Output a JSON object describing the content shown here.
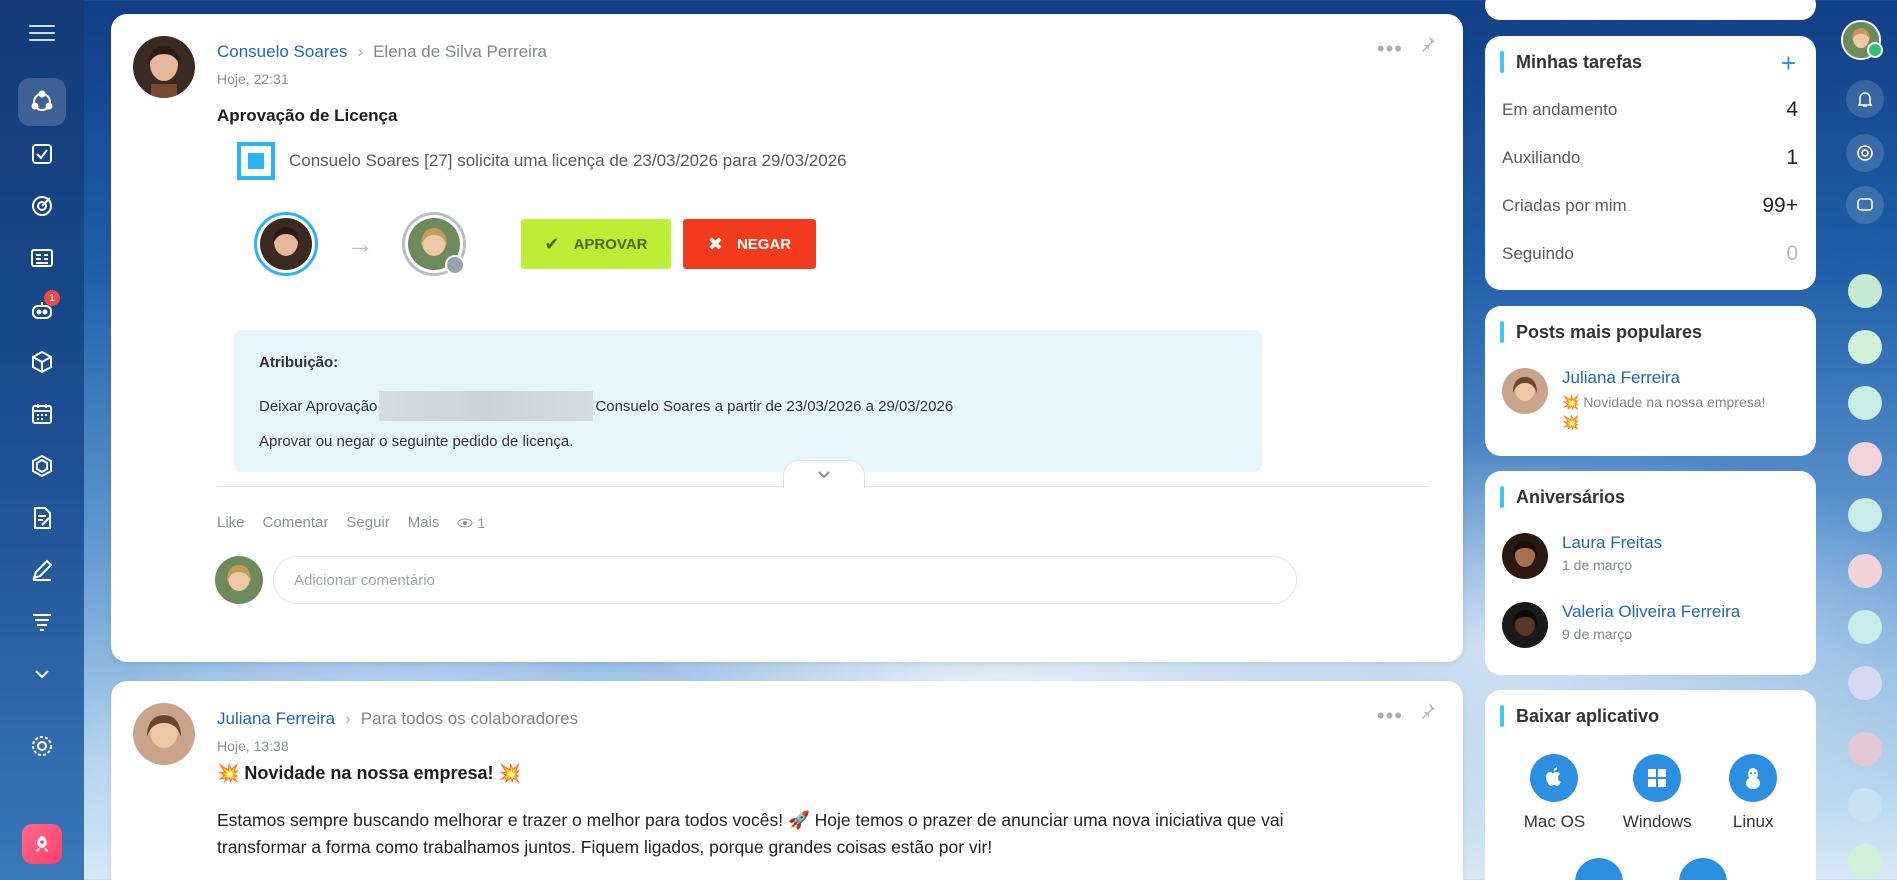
{
  "post1": {
    "author": "Consuelo Soares",
    "target": "Elena de Silva Perreira",
    "time": "Hoje, 22:31",
    "title": "Aprovação de Licença",
    "request": "Consuelo Soares [27] solicita uma licença de 23/03/2026 para 29/03/2026",
    "approve_label": "APROVAR",
    "deny_label": "NEGAR",
    "assignment_label": "Atribuição:",
    "assignment_line_start": "Deixar Aprovação",
    "assignment_line_end": "Consuelo Soares a partir de 23/03/2026 a 29/03/2026",
    "assignment_line2": "Aprovar ou negar o seguinte pedido de licença.",
    "actions": {
      "like": "Like",
      "comment": "Comentar",
      "follow": "Seguir",
      "more": "Mais",
      "views": "1"
    },
    "comment_placeholder": "Adicionar comentário"
  },
  "post2": {
    "author": "Juliana Ferreira",
    "target": "Para todos os colaboradores",
    "time": "Hoje, 13:38",
    "title": "💥 Novidade na nossa empresa! 💥",
    "body": "Estamos sempre buscando melhorar e trazer o melhor para todos vocês! 🚀 Hoje temos o prazer de anunciar uma nova iniciativa que vai transformar a forma como trabalhamos juntos. Fiquem ligados, porque grandes coisas estão por vir!"
  },
  "tasks": {
    "title": "Minhas tarefas",
    "rows": [
      {
        "label": "Em andamento",
        "count": "4"
      },
      {
        "label": "Auxiliando",
        "count": "1"
      },
      {
        "label": "Criadas por mim",
        "count": "99+"
      },
      {
        "label": "Seguindo",
        "count": "0"
      }
    ]
  },
  "popular": {
    "title": "Posts mais populares",
    "name": "Juliana Ferreira",
    "snippet": "💥 Novidade na nossa empresa! 💥"
  },
  "birthdays": {
    "title": "Aniversários",
    "people": [
      {
        "name": "Laura Freitas",
        "date": "1 de março"
      },
      {
        "name": "Valeria Oliveira Ferreira",
        "date": "9 de março"
      }
    ]
  },
  "apps": {
    "title": "Baixar aplicativo",
    "items": [
      "Mac OS",
      "Windows",
      "Linux"
    ]
  },
  "sidebar": {
    "badge": "1"
  },
  "colors": {
    "accent": "#2067b0",
    "approve": "#bbee34",
    "deny": "#f23b1e",
    "highlight": "#3bc8f5"
  }
}
